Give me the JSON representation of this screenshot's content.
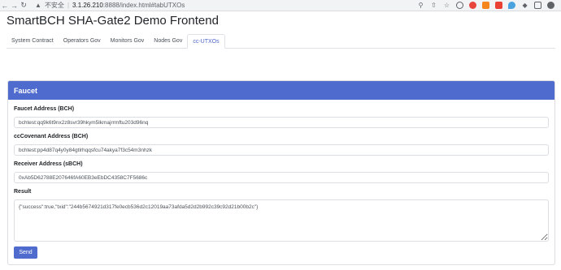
{
  "browser": {
    "security_label": "不安全",
    "host": "3.1.26.210",
    "port_path": ":8888/index.html#tabUTXOs",
    "icons": [
      "back-icon",
      "forward-icon",
      "reload-icon",
      "warning-icon",
      "zoom-icon",
      "share-icon",
      "star-icon",
      "extension-icons",
      "puzzle-icon",
      "sidebar-icon",
      "profile-icon"
    ]
  },
  "page": {
    "title": "SmartBCH SHA-Gate2 Demo Frontend"
  },
  "tabs": [
    {
      "label": "System Contract"
    },
    {
      "label": "Operators Gov"
    },
    {
      "label": "Monitors Gov"
    },
    {
      "label": "Nodes Gov"
    },
    {
      "label": "cc-UTXOs"
    }
  ],
  "active_tab": "cc-UTXOs",
  "faucet": {
    "header": "Faucet",
    "faucet_address_label": "Faucet Address (BCH)",
    "faucet_address_value": "bchtest:qq9k6t9nx2z8svr39hkym5lkmajrrmftu203d96nq",
    "covenant_address_label": "ccCovenant Address (BCH)",
    "covenant_address_value": "bchtest:pp4d87q4y0y84gtlrhqqsfcu74akya7f3c54m3nhzk",
    "receiver_address_label": "Receiver Address (sBCH)",
    "receiver_address_value": "0xAb5D62788E207646fA60EB3eEbDC4358C7F5686c",
    "result_label": "Result",
    "result_value": "{\"success\":true,\"txid\":\"244b5674921d317fe0ecb536d2c12019aa73afda5d2d2b992c39c92d21b00b2c\"}",
    "send_label": "Send"
  },
  "colors": {
    "accent": "#4f6bce",
    "tab_active": "#4d68c6"
  }
}
